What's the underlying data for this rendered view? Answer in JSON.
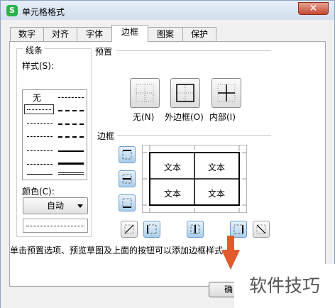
{
  "window": {
    "app_icon": "S",
    "title": "单元格格式",
    "close": "✕"
  },
  "tabs": [
    "数字",
    "对齐",
    "字体",
    "边框",
    "图案",
    "保护"
  ],
  "active_tab": "边框",
  "line_group": {
    "title": "线条",
    "style_label": "样式(S):",
    "none_label": "无",
    "color_label": "颜色(C):",
    "color_value": "自动"
  },
  "preset_group": {
    "title": "预置",
    "items": [
      {
        "label": "无(N)"
      },
      {
        "label": "外边框(O)"
      },
      {
        "label": "内部(I)"
      }
    ]
  },
  "border_group": {
    "title": "边框",
    "cell_text": [
      "文本",
      "文本",
      "文本",
      "文本"
    ]
  },
  "hint": "单击预置选项、预览草图及上面的按钮可以添加边框样式。",
  "ok_label": "确",
  "watermark": "软件技巧",
  "colors": {
    "accent": "#2bb24a",
    "button_blue": "#a9cdea",
    "arrow": "#e05a2a"
  }
}
